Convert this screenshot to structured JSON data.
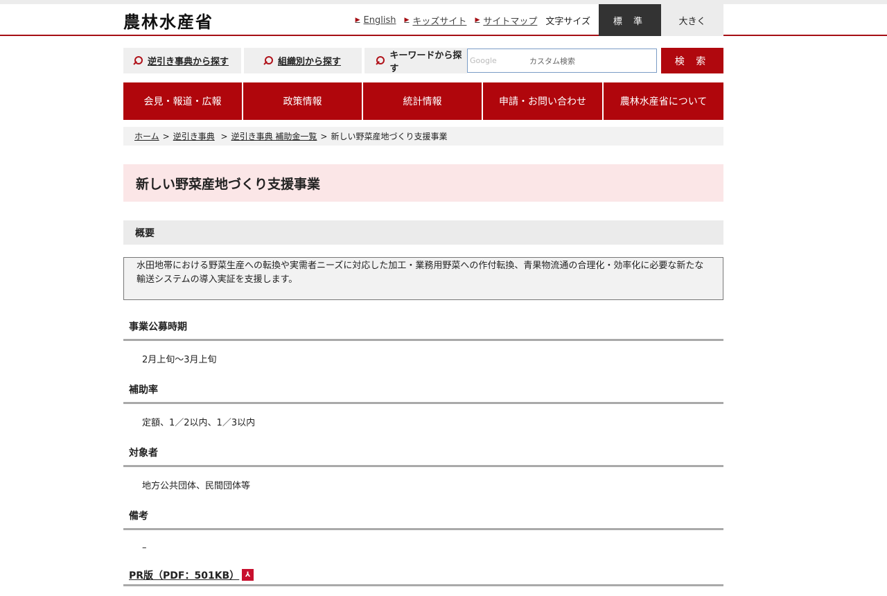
{
  "header": {
    "logo": "農林水産省",
    "util_links": [
      "English",
      "キッズサイト",
      "サイトマップ"
    ],
    "font_size_label": "文字サイズ",
    "font_standard": "標 準",
    "font_large": "大きく"
  },
  "search": {
    "reverse_lookup": "逆引き事典から探す",
    "by_org": "組織別から探す",
    "keyword": "キーワードから探す",
    "google_label": "Google",
    "placeholder": "カスタム検索",
    "submit": "検 索"
  },
  "gnav": [
    "会見・報道・広報",
    "政策情報",
    "統計情報",
    "申請・お問い合わせ",
    "農林水産省について"
  ],
  "breadcrumb": {
    "items": [
      "ホーム",
      "逆引き事典",
      "逆引き事典 補助金一覧"
    ],
    "current": "新しい野菜産地づくり支援事業"
  },
  "page": {
    "title": "新しい野菜産地づくり支援事業",
    "overview_heading": "概要",
    "overview_text": "水田地帯における野菜生産への転換や実需者ニーズに対応した加工・業務用野菜への作付転換、青果物流通の合理化・効率化に必要な新たな輸送システムの導入実証を支援します。",
    "sections": [
      {
        "heading": "事業公募時期",
        "body": "2月上旬〜3月上旬"
      },
      {
        "heading": "補助率",
        "body": "定額、1／2以内、1／3以内"
      },
      {
        "heading": "対象者",
        "body": "地方公共団体、民間団体等"
      },
      {
        "heading": "備考",
        "body": "–"
      }
    ],
    "pdf_link": "PR版（PDF：501KB）"
  },
  "colors": {
    "brand_red": "#b0060c",
    "title_bg": "#fbe6e7"
  }
}
